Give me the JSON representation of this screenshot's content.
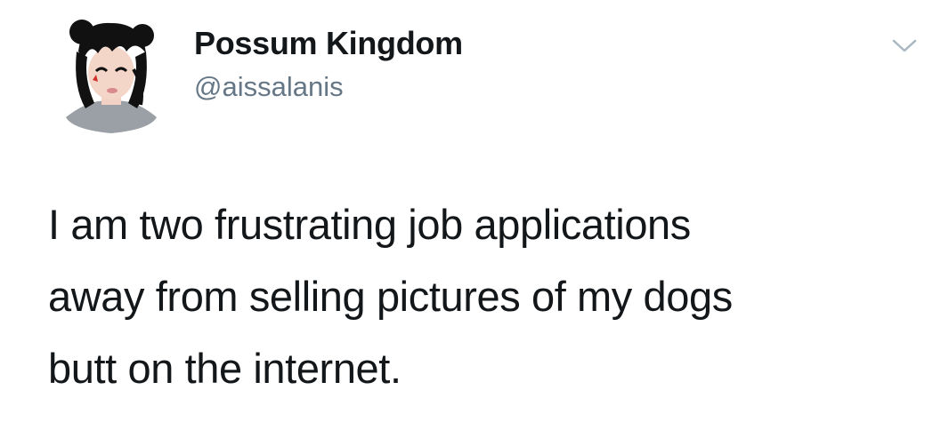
{
  "tweet": {
    "author": {
      "display_name": "Possum Kingdom",
      "handle": "@aissalanis",
      "avatar_icon": "illustrated-woman-avatar"
    },
    "menu_icon": "chevron-down-icon",
    "text_lines": [
      "I am two frustrating job applications",
      "away from selling pictures of my dogs",
      "butt on the internet."
    ]
  },
  "colors": {
    "text": "#14171a",
    "handle": "#657786",
    "background": "#ffffff",
    "caret": "#aab8c2"
  }
}
